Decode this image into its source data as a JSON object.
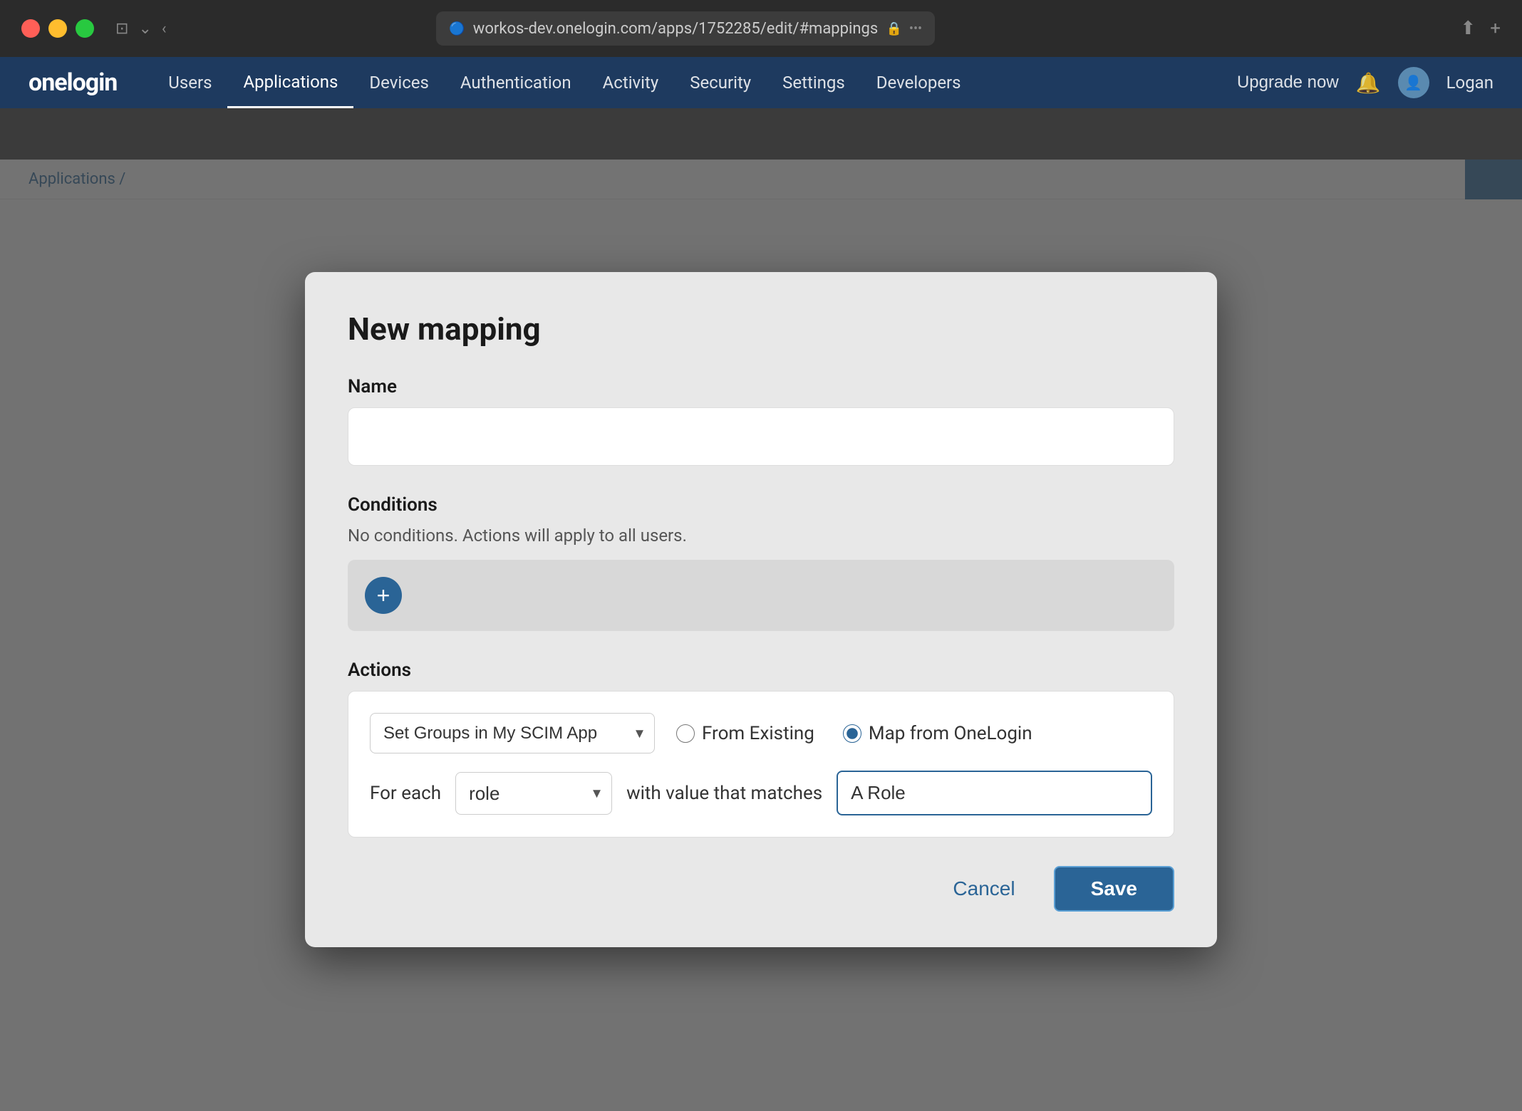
{
  "titlebar": {
    "url": "workos-dev.onelogin.com/apps/1752285/edit/#mappings",
    "back_icon": "‹",
    "window_icon": "⊞"
  },
  "navbar": {
    "logo": "onelogin",
    "items": [
      {
        "label": "Users"
      },
      {
        "label": "Applications"
      },
      {
        "label": "Devices"
      },
      {
        "label": "Authentication"
      },
      {
        "label": "Activity"
      },
      {
        "label": "Security"
      },
      {
        "label": "Settings"
      },
      {
        "label": "Developers"
      }
    ],
    "upgrade_label": "Upgrade now",
    "user_label": "Logan"
  },
  "breadcrumb": {
    "text": "Applications /"
  },
  "modal": {
    "title": "New mapping",
    "name_label": "Name",
    "name_placeholder": "",
    "conditions_label": "Conditions",
    "conditions_desc": "No conditions. Actions will apply to all users.",
    "add_condition_label": "+",
    "actions_label": "Actions",
    "action_select_value": "Set Groups in My SCIM App",
    "action_options": [
      "Set Groups in My SCIM App"
    ],
    "radio_from_existing": "From Existing",
    "radio_map_from": "Map from OneLogin",
    "for_each_label": "For each",
    "role_select_value": "role",
    "role_options": [
      "role"
    ],
    "with_value_label": "with value that matches",
    "value_input_value": "A Role",
    "cancel_label": "Cancel",
    "save_label": "Save"
  },
  "colors": {
    "primary": "#2a6496",
    "modal_bg": "#e8e8e8",
    "conditions_box": "#d8d8d8"
  }
}
